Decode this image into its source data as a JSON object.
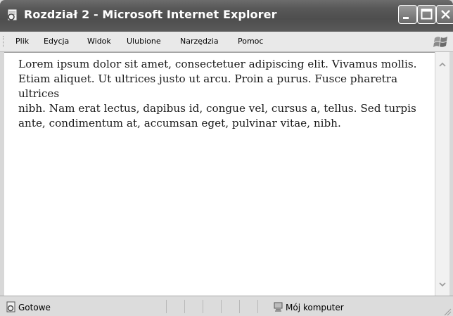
{
  "window": {
    "title": "Rozdział 2 - Microsoft Internet Explorer"
  },
  "menu": {
    "items": [
      {
        "label": "Plik"
      },
      {
        "label": "Edycja"
      },
      {
        "label": "Widok"
      },
      {
        "label": "Ulubione"
      },
      {
        "label": "Narzędzia"
      },
      {
        "label": "Pomoc"
      }
    ]
  },
  "content": {
    "lines": [
      "Lorem ipsum dolor sit amet, consectetuer adipiscing elit. Vivamus mollis.",
      "Etiam aliquet. Ut ultrices justo ut arcu. Proin a purus. Fusce pharetra ultrices",
      "nibh. Nam erat lectus, dapibus id, congue vel, cursus a, tellus. Sed turpis",
      "ante, condimentum at, accumsan eget, pulvinar vitae, nibh."
    ]
  },
  "status": {
    "left_text": "Gotowe",
    "zone_text": "Mój komputer"
  },
  "icons": {
    "title": "ie-page-icon",
    "logo": "windows-flag-icon",
    "status_left": "page-done-icon",
    "status_zone": "my-computer-icon"
  }
}
